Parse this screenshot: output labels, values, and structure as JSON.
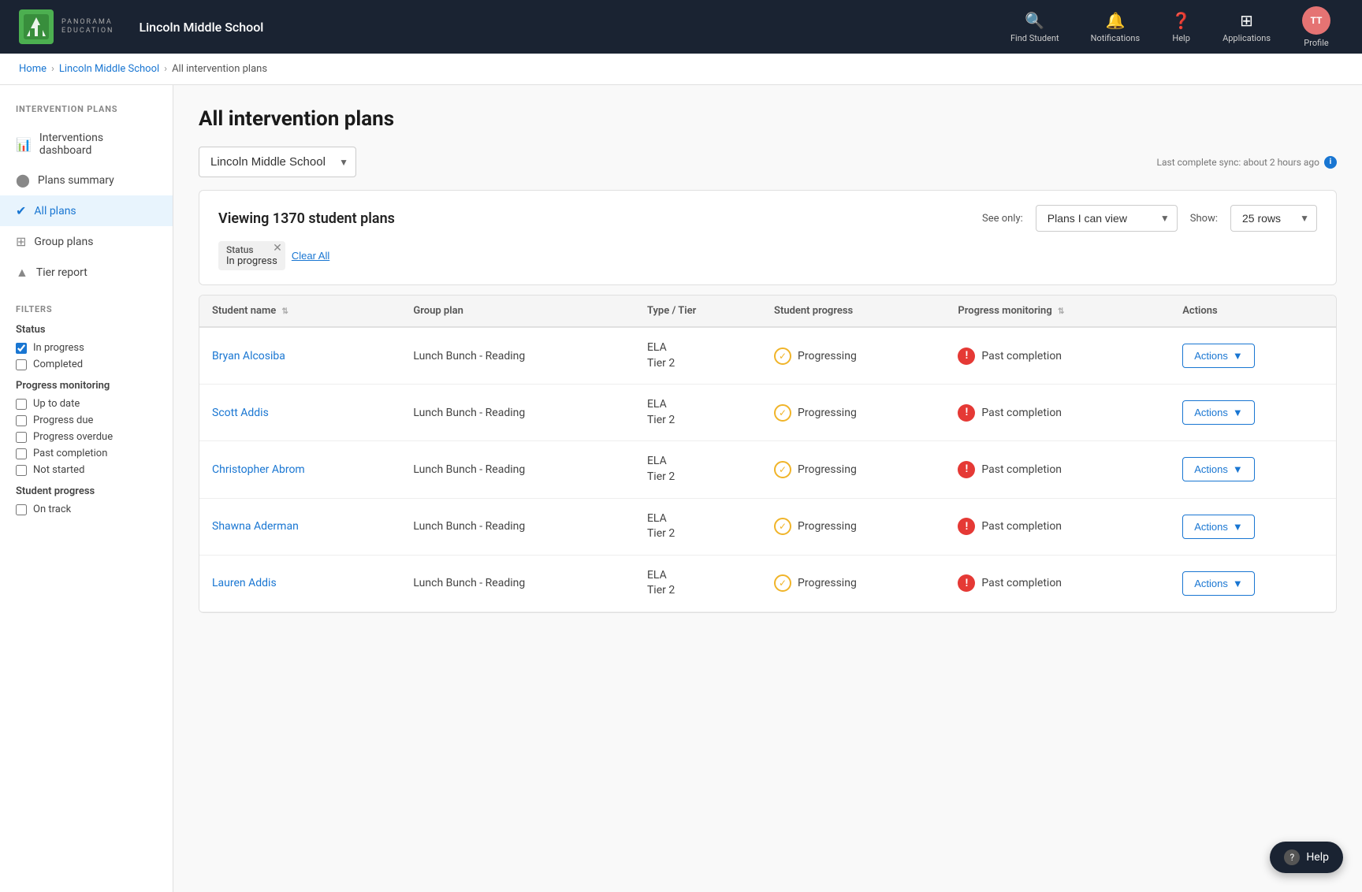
{
  "nav": {
    "logo_text": "PANORAMA",
    "logo_subtext": "EDUCATION",
    "school_name": "Lincoln Middle School",
    "find_student_label": "Find Student",
    "notifications_label": "Notifications",
    "help_label": "Help",
    "applications_label": "Applications",
    "profile_label": "Profile",
    "profile_initials": "TT"
  },
  "breadcrumb": {
    "home": "Home",
    "school": "Lincoln Middle School",
    "current": "All intervention plans"
  },
  "sidebar": {
    "section_title": "INTERVENTION PLANS",
    "items": [
      {
        "label": "Interventions dashboard",
        "icon": "📊",
        "active": false
      },
      {
        "label": "Plans summary",
        "icon": "🔵",
        "active": false
      },
      {
        "label": "All plans",
        "icon": "✔",
        "active": true
      },
      {
        "label": "Group plans",
        "icon": "⊞",
        "active": false
      },
      {
        "label": "Tier report",
        "icon": "▲",
        "active": false
      }
    ],
    "filters_title": "FILTERS",
    "status_title": "Status",
    "status_filters": [
      {
        "label": "In progress",
        "checked": true
      },
      {
        "label": "Completed",
        "checked": false
      }
    ],
    "progress_monitoring_title": "Progress monitoring",
    "progress_filters": [
      {
        "label": "Up to date",
        "checked": false
      },
      {
        "label": "Progress due",
        "checked": false
      },
      {
        "label": "Progress overdue",
        "checked": false
      },
      {
        "label": "Past completion",
        "checked": false
      },
      {
        "label": "Not started",
        "checked": false
      }
    ],
    "student_progress_title": "Student progress",
    "student_progress_filters": [
      {
        "label": "On track",
        "checked": false
      }
    ]
  },
  "page": {
    "title": "All intervention plans",
    "school_selector": "Lincoln Middle School",
    "sync_info": "Last complete sync:  about 2 hours ago",
    "viewing_count": "Viewing 1370 student plans",
    "see_only_label": "See only:",
    "see_only_value": "Plans I can view",
    "show_label": "Show:",
    "show_value": "25 rows",
    "filter_tag_label": "Status",
    "filter_tag_value": "In progress",
    "clear_all": "Clear All"
  },
  "table": {
    "columns": [
      {
        "label": "Student name",
        "sortable": true
      },
      {
        "label": "Group plan",
        "sortable": false
      },
      {
        "label": "Type / Tier",
        "sortable": false
      },
      {
        "label": "Student progress",
        "sortable": false
      },
      {
        "label": "Progress monitoring",
        "sortable": true
      },
      {
        "label": "Actions",
        "sortable": false
      }
    ],
    "rows": [
      {
        "student_name": "Bryan Alcosiba",
        "group_plan": "Lunch Bunch - Reading",
        "type": "ELA",
        "tier": "Tier 2",
        "student_progress": "Progressing",
        "progress_monitoring": "Past completion",
        "actions": "Actions"
      },
      {
        "student_name": "Scott Addis",
        "group_plan": "Lunch Bunch - Reading",
        "type": "ELA",
        "tier": "Tier 2",
        "student_progress": "Progressing",
        "progress_monitoring": "Past completion",
        "actions": "Actions"
      },
      {
        "student_name": "Christopher Abrom",
        "group_plan": "Lunch Bunch - Reading",
        "type": "ELA",
        "tier": "Tier 2",
        "student_progress": "Progressing",
        "progress_monitoring": "Past completion",
        "actions": "Actions"
      },
      {
        "student_name": "Shawna Aderman",
        "group_plan": "Lunch Bunch - Reading",
        "type": "ELA",
        "tier": "Tier 2",
        "student_progress": "Progressing",
        "progress_monitoring": "Past completion",
        "actions": "Actions"
      },
      {
        "student_name": "Lauren Addis",
        "group_plan": "Lunch Bunch - Reading",
        "type": "ELA",
        "tier": "Tier 2",
        "student_progress": "Progressing",
        "progress_monitoring": "Past completion",
        "actions": "Actions"
      }
    ]
  },
  "help_fab": "⊕ Help"
}
